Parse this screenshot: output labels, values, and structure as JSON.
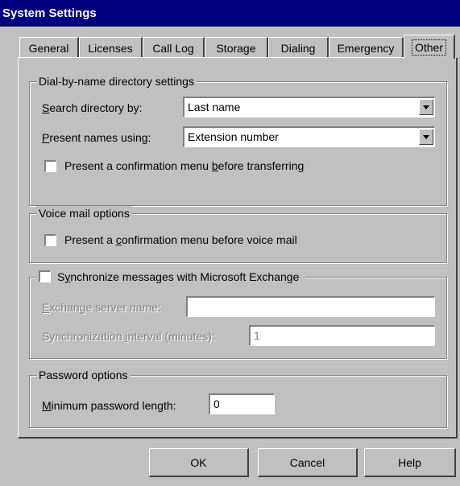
{
  "window": {
    "title": "System Settings"
  },
  "tabs": [
    {
      "label": "General"
    },
    {
      "label": "Licenses"
    },
    {
      "label": "Call Log"
    },
    {
      "label": "Storage"
    },
    {
      "label": "Dialing"
    },
    {
      "label": "Emergency"
    },
    {
      "label": "Other",
      "active": true
    }
  ],
  "dialbyname": {
    "legend": "Dial-by-name directory settings",
    "search_label_pre": "",
    "search_label_key": "S",
    "search_label_post": "earch directory by:",
    "search_value": "Last name",
    "present_label_key": "P",
    "present_label_post": "resent names using:",
    "present_value": "Extension number",
    "confirm_pre": "Present a confirmation menu ",
    "confirm_key": "b",
    "confirm_post": "efore transferring",
    "confirm_checked": false
  },
  "voicemail": {
    "legend": "Voice mail options",
    "confirm_pre": "Present a ",
    "confirm_key": "c",
    "confirm_post": "onfirmation menu before voice mail",
    "confirm_checked": false
  },
  "exchange": {
    "sync_pre": "S",
    "sync_key": "y",
    "sync_post": "nchronize messages with Microsoft Exchange",
    "sync_checked": false,
    "server_key": "E",
    "server_post": "xchange server name:",
    "server_value": "",
    "interval_pre": "Synchronization ",
    "interval_key": "i",
    "interval_post": "nterval (minutes):",
    "interval_value": "1"
  },
  "password": {
    "legend": "Password options",
    "min_key": "M",
    "min_post": "inimum password length:",
    "min_value": "0"
  },
  "buttons": {
    "ok": "OK",
    "cancel": "Cancel",
    "help": "Help"
  }
}
